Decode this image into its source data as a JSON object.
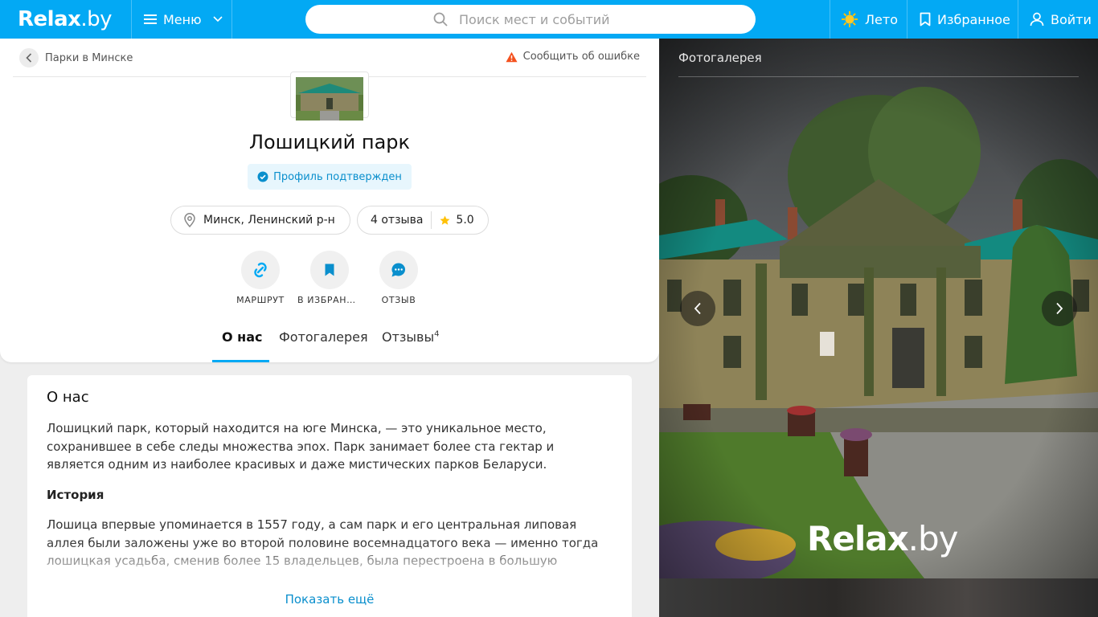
{
  "header": {
    "logo_main": "Relax",
    "logo_domain": ".by",
    "menu_label": "Меню",
    "search_placeholder": "Поиск мест и событий",
    "season_label": "Лето",
    "favorites_label": "Избранное",
    "login_label": "Войти",
    "accent_color": "#03a9f4"
  },
  "breadcrumb": {
    "back_label": "Парки в Минске"
  },
  "report_label": "Сообщить об ошибке",
  "place": {
    "title": "Лошицкий парк",
    "verified_label": "Профиль подтвержден",
    "location": "Минск, Ленинский р-н",
    "reviews_count": "4 отзыва",
    "rating": "5.0"
  },
  "actions": [
    {
      "label": "МАРШРУТ",
      "icon": "route-icon"
    },
    {
      "label": "В ИЗБРАННОЕ",
      "icon": "bookmark-icon"
    },
    {
      "label": "ОТЗЫВ",
      "icon": "chat-icon"
    }
  ],
  "tabs": [
    {
      "label": "О нас",
      "active": true
    },
    {
      "label": "Фотогалерея"
    },
    {
      "label": "Отзывы",
      "badge": "4"
    }
  ],
  "about": {
    "heading": "О нас",
    "intro": "Лошицкий парк, который находится на юге Минска, — это уникальное место, сохранившее в себе следы множества эпох. Парк занимает более ста гектар и является одним из наиболее красивых и даже мистических парков Беларуси.",
    "history_heading": "История",
    "history_text": "Лошица впервые упоминается в 1557 году, а сам парк и его центральная липовая аллея были заложены уже во второй половине восемнадцатого века — именно тогда лошицкая усадьба, сменив более 15 владельцев, была перестроена в большую",
    "show_more": "Показать ещё"
  },
  "gallery": {
    "heading": "Фотогалерея",
    "watermark_main": "Relax",
    "watermark_domain": ".by"
  }
}
